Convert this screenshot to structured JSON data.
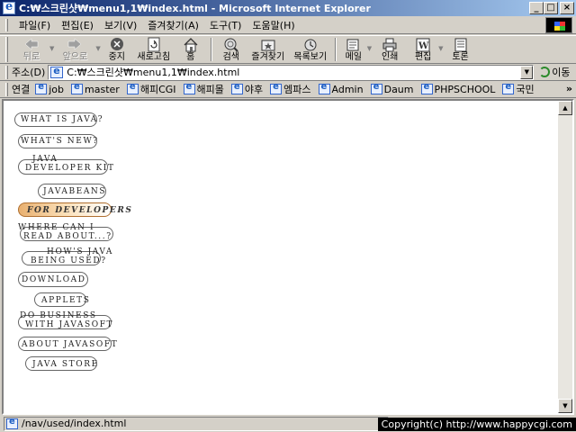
{
  "window": {
    "title": "C:₩스크린샷₩menu1,1₩index.html - Microsoft Internet Explorer",
    "buttons": [
      "_",
      "□",
      "×"
    ]
  },
  "menubar": {
    "items": [
      "파일(F)",
      "편집(E)",
      "보기(V)",
      "즐겨찾기(A)",
      "도구(T)",
      "도움말(H)"
    ]
  },
  "toolbar": {
    "back": "뒤로",
    "forward": "앞으로",
    "stop": "중지",
    "refresh": "새로고침",
    "home": "홈",
    "search": "검색",
    "favorites": "즐겨찾기",
    "history": "목록보기",
    "mail": "메일",
    "print": "인쇄",
    "edit": "편집",
    "discuss": "토론"
  },
  "address": {
    "label": "주소(D)",
    "value": "C:₩스크린샷₩menu1,1₩index.html",
    "go": "이동"
  },
  "links": {
    "label": "연결",
    "items": [
      "job",
      "master",
      "해피CGI",
      "해피몰",
      "야후",
      "엠파스",
      "Admin",
      "Daum",
      "PHPSCHOOL",
      "국민"
    ],
    "more": "»"
  },
  "nav": {
    "items": [
      {
        "line1": "What is Java?",
        "line2": ""
      },
      {
        "line1": "What's New?",
        "line2": ""
      },
      {
        "line1": "Java",
        "line2": "Developer Kit"
      },
      {
        "line1": "JavaBeans",
        "line2": ""
      },
      {
        "line1": "For Developers",
        "line2": ""
      },
      {
        "line1": "Where can I",
        "line2": "Read About...?"
      },
      {
        "line1": "How's Java",
        "line2": "Being Used?"
      },
      {
        "line1": "Download",
        "line2": ""
      },
      {
        "line1": "Applets",
        "line2": ""
      },
      {
        "line1": "Do Business",
        "line2": "with JavaSoft"
      },
      {
        "line1": "About JavaSoft",
        "line2": ""
      },
      {
        "line1": "Java Store",
        "line2": ""
      }
    ],
    "active_index": 4
  },
  "status": {
    "text": "/nav/used/index.html",
    "copyright": "Copyright(c) http://www.happycgi.com"
  },
  "colors": {
    "titlebar_start": "#0a246a",
    "titlebar_end": "#a6caf0",
    "chrome": "#d4d0c8",
    "active_nav": "#e8b070"
  }
}
